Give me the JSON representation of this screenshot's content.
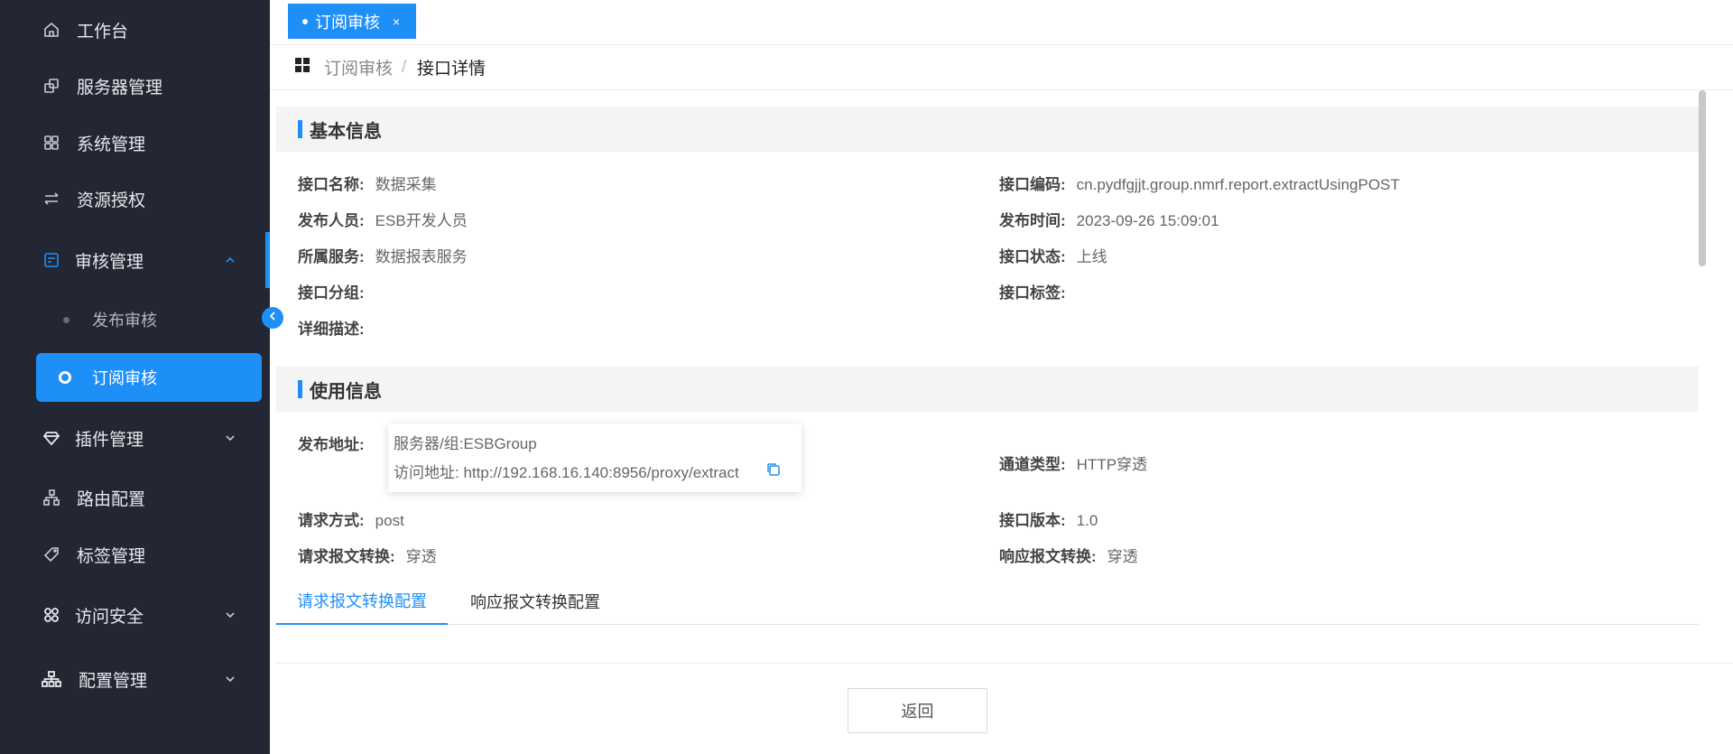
{
  "sidebar": {
    "items": [
      {
        "label": "工作台",
        "icon": "home-icon"
      },
      {
        "label": "服务器管理",
        "icon": "server-icon"
      },
      {
        "label": "系统管理",
        "icon": "grid-icon"
      },
      {
        "label": "资源授权",
        "icon": "transfer-icon"
      },
      {
        "label": "审核管理",
        "icon": "audit-icon",
        "expanded": true
      },
      {
        "label": "插件管理",
        "icon": "diamond-icon"
      },
      {
        "label": "路由配置",
        "icon": "tree-icon"
      },
      {
        "label": "标签管理",
        "icon": "tag-icon"
      },
      {
        "label": "访问安全",
        "icon": "shield-grid-icon"
      },
      {
        "label": "配置管理",
        "icon": "org-icon"
      }
    ],
    "sub_items": [
      {
        "label": "发布审核"
      },
      {
        "label": "订阅审核",
        "active": true
      }
    ]
  },
  "tabs": [
    {
      "label": "订阅审核",
      "close": "×"
    }
  ],
  "breadcrumb": {
    "items": [
      "订阅审核",
      "接口详情"
    ],
    "separator": "/"
  },
  "basic_info": {
    "title": "基本信息",
    "fields": {
      "name": {
        "label": "接口名称:",
        "value": "数据采集"
      },
      "code": {
        "label": "接口编码:",
        "value": "cn.pydfgjjt.group.nmrf.report.extractUsingPOST"
      },
      "publisher": {
        "label": "发布人员:",
        "value": "ESB开发人员"
      },
      "publish_time": {
        "label": "发布时间:",
        "value": "2023-09-26 15:09:01"
      },
      "service": {
        "label": "所属服务:",
        "value": "数据报表服务"
      },
      "status": {
        "label": "接口状态:",
        "value": "上线"
      },
      "group": {
        "label": "接口分组:",
        "value": ""
      },
      "tags": {
        "label": "接口标签:",
        "value": ""
      },
      "description": {
        "label": "详细描述:",
        "value": ""
      }
    }
  },
  "usage_info": {
    "title": "使用信息",
    "fields": {
      "publish_address": {
        "label": "发布地址:",
        "server_group": "服务器/组:ESBGroup",
        "access_url": "访问地址: http://192.168.16.140:8956/proxy/extract"
      },
      "channel_type": {
        "label": "通道类型:",
        "value": "HTTP穿透"
      },
      "request_method": {
        "label": "请求方式:",
        "value": "post"
      },
      "version": {
        "label": "接口版本:",
        "value": "1.0"
      },
      "request_conversion": {
        "label": "请求报文转换:",
        "value": "穿透"
      },
      "response_conversion": {
        "label": "响应报文转换:",
        "value": "穿透"
      }
    }
  },
  "config_tabs": [
    {
      "label": "请求报文转换配置",
      "active": true
    },
    {
      "label": "响应报文转换配置"
    }
  ],
  "actions": {
    "back_label": "返回"
  },
  "colors": {
    "accent": "#1f8ff8",
    "sidebar_bg": "#232734"
  }
}
